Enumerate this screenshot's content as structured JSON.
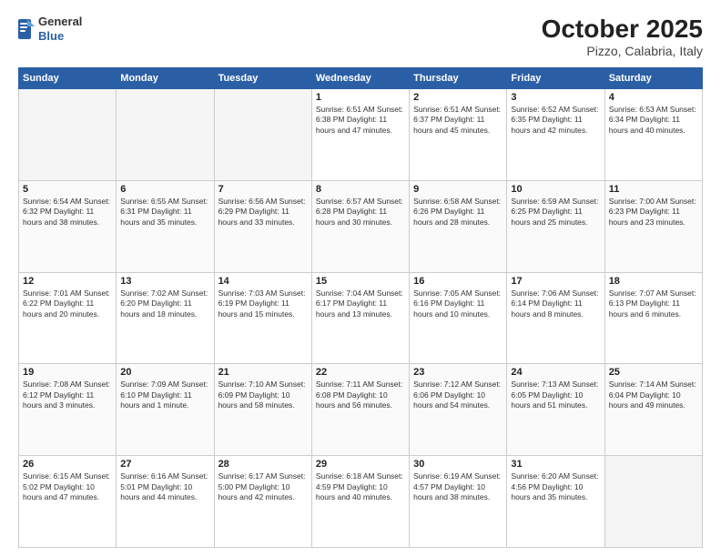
{
  "header": {
    "logo": {
      "general": "General",
      "blue": "Blue"
    },
    "title": "October 2025",
    "subtitle": "Pizzo, Calabria, Italy"
  },
  "weekdays": [
    "Sunday",
    "Monday",
    "Tuesday",
    "Wednesday",
    "Thursday",
    "Friday",
    "Saturday"
  ],
  "weeks": [
    [
      {
        "day": "",
        "info": ""
      },
      {
        "day": "",
        "info": ""
      },
      {
        "day": "",
        "info": ""
      },
      {
        "day": "1",
        "info": "Sunrise: 6:51 AM\nSunset: 6:38 PM\nDaylight: 11 hours\nand 47 minutes."
      },
      {
        "day": "2",
        "info": "Sunrise: 6:51 AM\nSunset: 6:37 PM\nDaylight: 11 hours\nand 45 minutes."
      },
      {
        "day": "3",
        "info": "Sunrise: 6:52 AM\nSunset: 6:35 PM\nDaylight: 11 hours\nand 42 minutes."
      },
      {
        "day": "4",
        "info": "Sunrise: 6:53 AM\nSunset: 6:34 PM\nDaylight: 11 hours\nand 40 minutes."
      }
    ],
    [
      {
        "day": "5",
        "info": "Sunrise: 6:54 AM\nSunset: 6:32 PM\nDaylight: 11 hours\nand 38 minutes."
      },
      {
        "day": "6",
        "info": "Sunrise: 6:55 AM\nSunset: 6:31 PM\nDaylight: 11 hours\nand 35 minutes."
      },
      {
        "day": "7",
        "info": "Sunrise: 6:56 AM\nSunset: 6:29 PM\nDaylight: 11 hours\nand 33 minutes."
      },
      {
        "day": "8",
        "info": "Sunrise: 6:57 AM\nSunset: 6:28 PM\nDaylight: 11 hours\nand 30 minutes."
      },
      {
        "day": "9",
        "info": "Sunrise: 6:58 AM\nSunset: 6:26 PM\nDaylight: 11 hours\nand 28 minutes."
      },
      {
        "day": "10",
        "info": "Sunrise: 6:59 AM\nSunset: 6:25 PM\nDaylight: 11 hours\nand 25 minutes."
      },
      {
        "day": "11",
        "info": "Sunrise: 7:00 AM\nSunset: 6:23 PM\nDaylight: 11 hours\nand 23 minutes."
      }
    ],
    [
      {
        "day": "12",
        "info": "Sunrise: 7:01 AM\nSunset: 6:22 PM\nDaylight: 11 hours\nand 20 minutes."
      },
      {
        "day": "13",
        "info": "Sunrise: 7:02 AM\nSunset: 6:20 PM\nDaylight: 11 hours\nand 18 minutes."
      },
      {
        "day": "14",
        "info": "Sunrise: 7:03 AM\nSunset: 6:19 PM\nDaylight: 11 hours\nand 15 minutes."
      },
      {
        "day": "15",
        "info": "Sunrise: 7:04 AM\nSunset: 6:17 PM\nDaylight: 11 hours\nand 13 minutes."
      },
      {
        "day": "16",
        "info": "Sunrise: 7:05 AM\nSunset: 6:16 PM\nDaylight: 11 hours\nand 10 minutes."
      },
      {
        "day": "17",
        "info": "Sunrise: 7:06 AM\nSunset: 6:14 PM\nDaylight: 11 hours\nand 8 minutes."
      },
      {
        "day": "18",
        "info": "Sunrise: 7:07 AM\nSunset: 6:13 PM\nDaylight: 11 hours\nand 6 minutes."
      }
    ],
    [
      {
        "day": "19",
        "info": "Sunrise: 7:08 AM\nSunset: 6:12 PM\nDaylight: 11 hours\nand 3 minutes."
      },
      {
        "day": "20",
        "info": "Sunrise: 7:09 AM\nSunset: 6:10 PM\nDaylight: 11 hours\nand 1 minute."
      },
      {
        "day": "21",
        "info": "Sunrise: 7:10 AM\nSunset: 6:09 PM\nDaylight: 10 hours\nand 58 minutes."
      },
      {
        "day": "22",
        "info": "Sunrise: 7:11 AM\nSunset: 6:08 PM\nDaylight: 10 hours\nand 56 minutes."
      },
      {
        "day": "23",
        "info": "Sunrise: 7:12 AM\nSunset: 6:06 PM\nDaylight: 10 hours\nand 54 minutes."
      },
      {
        "day": "24",
        "info": "Sunrise: 7:13 AM\nSunset: 6:05 PM\nDaylight: 10 hours\nand 51 minutes."
      },
      {
        "day": "25",
        "info": "Sunrise: 7:14 AM\nSunset: 6:04 PM\nDaylight: 10 hours\nand 49 minutes."
      }
    ],
    [
      {
        "day": "26",
        "info": "Sunrise: 6:15 AM\nSunset: 5:02 PM\nDaylight: 10 hours\nand 47 minutes."
      },
      {
        "day": "27",
        "info": "Sunrise: 6:16 AM\nSunset: 5:01 PM\nDaylight: 10 hours\nand 44 minutes."
      },
      {
        "day": "28",
        "info": "Sunrise: 6:17 AM\nSunset: 5:00 PM\nDaylight: 10 hours\nand 42 minutes."
      },
      {
        "day": "29",
        "info": "Sunrise: 6:18 AM\nSunset: 4:59 PM\nDaylight: 10 hours\nand 40 minutes."
      },
      {
        "day": "30",
        "info": "Sunrise: 6:19 AM\nSunset: 4:57 PM\nDaylight: 10 hours\nand 38 minutes."
      },
      {
        "day": "31",
        "info": "Sunrise: 6:20 AM\nSunset: 4:56 PM\nDaylight: 10 hours\nand 35 minutes."
      },
      {
        "day": "",
        "info": ""
      }
    ]
  ]
}
